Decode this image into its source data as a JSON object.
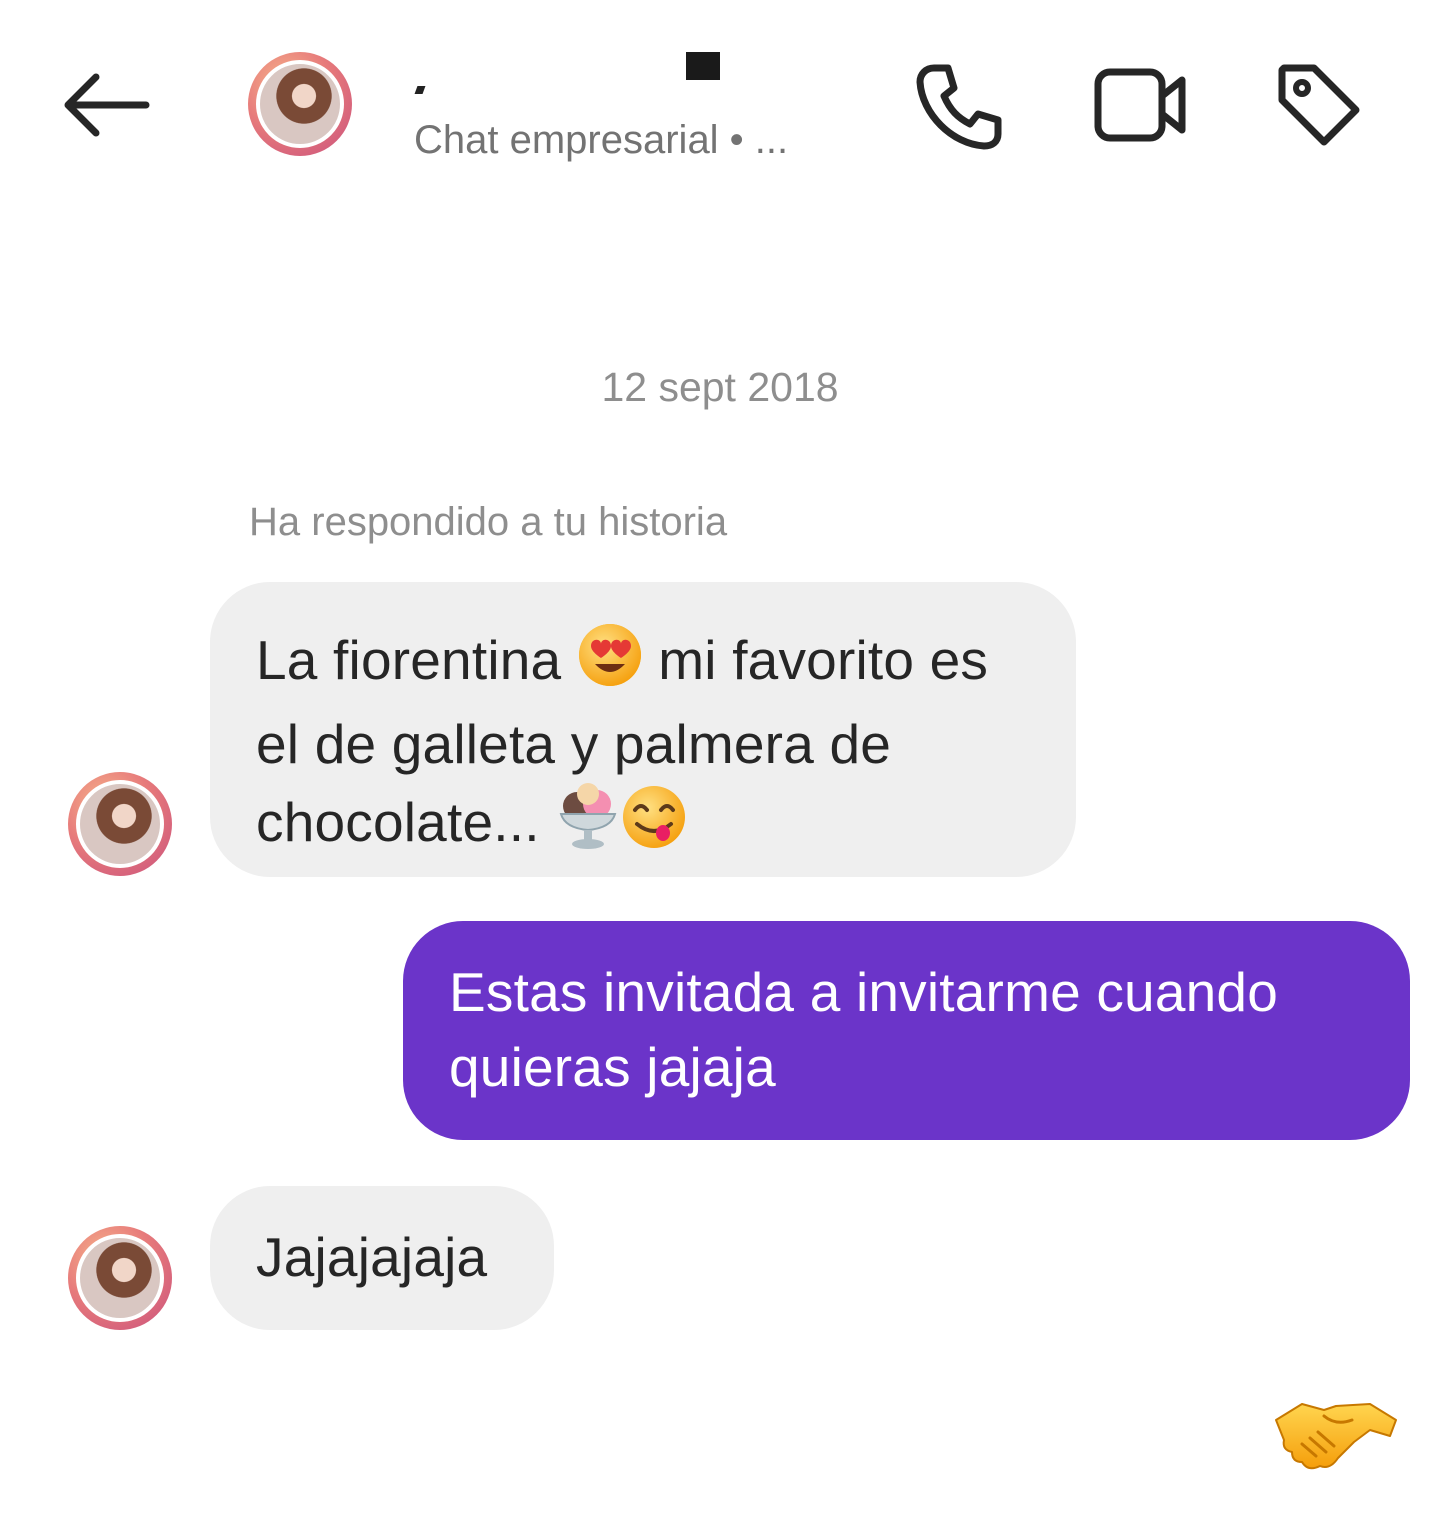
{
  "header": {
    "subtitle": "Chat empresarial • ...",
    "icons": {
      "back": "arrow-left-icon",
      "call": "phone-icon",
      "video": "video-camera-icon",
      "label": "tag-icon"
    }
  },
  "thread": {
    "date": "12 sept 2018",
    "reply_note": "Ha respondido a tu historia",
    "messages": [
      {
        "direction": "incoming",
        "parts": [
          "La fiorentina ",
          " mi favorito es el de galleta y palmera de chocolate... "
        ]
      },
      {
        "direction": "outgoing",
        "lines": [
          "Estas invitada a invitarme cuando",
          "quieras jajaja"
        ]
      },
      {
        "direction": "incoming",
        "text": "Jajajajaja"
      }
    ],
    "reaction": "handshake-emoji"
  },
  "colors": {
    "incoming_bubble": "#efefef",
    "outgoing_bubble": "#6b34c9",
    "muted_text": "#8e8e8e"
  }
}
